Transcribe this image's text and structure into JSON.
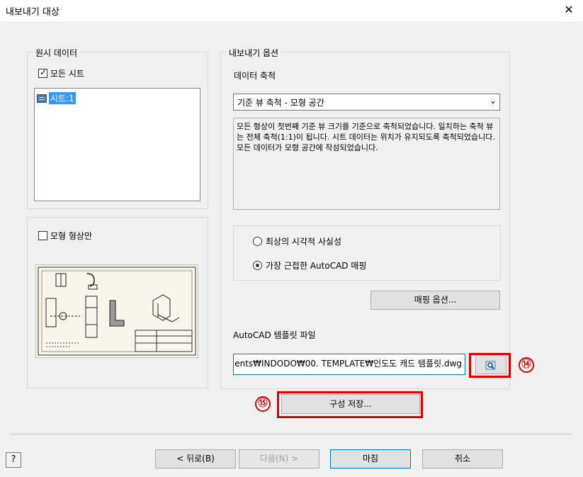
{
  "window": {
    "title": "내보내기 대상",
    "close": "✕"
  },
  "source": {
    "group_label": "원시 데이터",
    "all_sheets_label": "모든 시트",
    "all_sheets_checked": true,
    "sheets": [
      {
        "label": "시트:1"
      }
    ],
    "model_geometry_label": "모형 형상만",
    "model_geometry_checked": false
  },
  "options": {
    "group_label": "내보내기 옵션",
    "data_scale_label": "데이터 축척",
    "data_scale_value": "기준 뷰 축척 - 모형 공간",
    "description": "모든 형상이 첫번째 기준 뷰 크기를 기준으로 축척되었습니다. 일치하는 축척 뷰는 전체 축척(1:1)이 됩니다. 시트 데이터는 위치가 유지되도록 축척되었습니다. 모든 데이터가 모형 공간에 작성되었습니다.",
    "radio_best_visual": "최상의 시각적 사실성",
    "radio_closest_mapping": "가장 근접한 AutoCAD 매핑",
    "selected_radio": "closest_mapping",
    "mapping_button": "매핑 옵션...",
    "template_label": "AutoCAD 템플릿 파일",
    "template_path": "ents₩INDODO₩00. TEMPLATE₩인도도 캐드 템플릿.dwg"
  },
  "save_config_button": "구성 저장...",
  "annotations": {
    "browse": "⑭",
    "save": "⑮"
  },
  "footer": {
    "help": "?",
    "back": "< 뒤로(B)",
    "next": "다음(N) >",
    "finish": "마침",
    "cancel": "취소"
  },
  "colors": {
    "highlight": "#e00000",
    "selection": "#3399ff"
  }
}
